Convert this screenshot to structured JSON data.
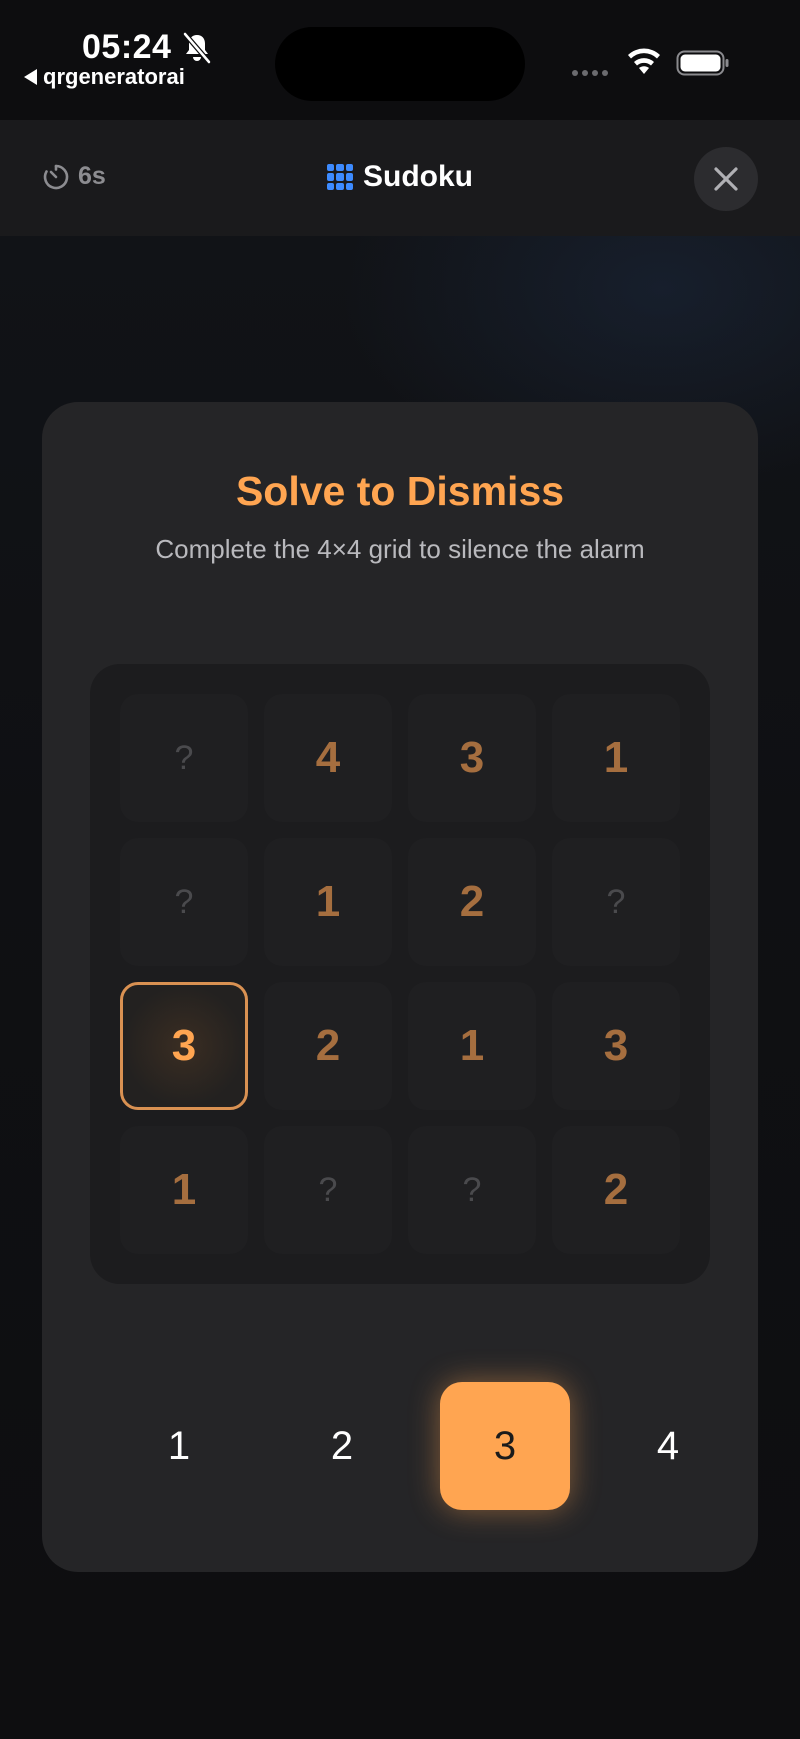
{
  "status_bar": {
    "time": "05:24",
    "back_app": "qrgeneratorai"
  },
  "header": {
    "timer": "6s",
    "title": "Sudoku",
    "accent_color": "#3d8bff"
  },
  "puzzle": {
    "title": "Solve to Dismiss",
    "subtitle": "Complete the 4×4 grid to silence the alarm",
    "accent_color": "#ffa551",
    "grid": [
      [
        "?",
        "4",
        "3",
        "1"
      ],
      [
        "?",
        "1",
        "2",
        "?"
      ],
      [
        "3",
        "2",
        "1",
        "3"
      ],
      [
        "1",
        "?",
        "?",
        "2"
      ]
    ],
    "selected_cell": {
      "row": 3,
      "col": 1
    }
  },
  "numpad": {
    "keys": [
      "1",
      "2",
      "3",
      "4"
    ],
    "active_key": "3"
  }
}
